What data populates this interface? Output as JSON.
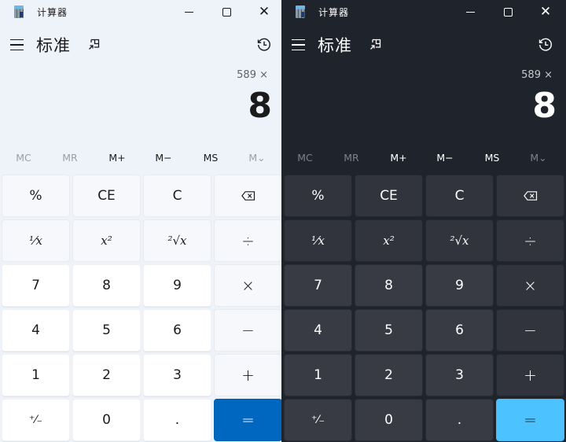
{
  "panels": [
    {
      "theme": "light",
      "app_title": "计算器",
      "mode_title": "标准",
      "expression": "589 ×",
      "result": "8",
      "memory": [
        "MC",
        "MR",
        "M+",
        "M−",
        "MS",
        "M⌄"
      ],
      "memory_disabled": [
        true,
        true,
        false,
        false,
        false,
        true
      ],
      "keys": [
        {
          "label": "%",
          "name": "percent",
          "kind": "fn"
        },
        {
          "label": "CE",
          "name": "clear-entry",
          "kind": "fn"
        },
        {
          "label": "C",
          "name": "clear",
          "kind": "fn"
        },
        {
          "label": "",
          "name": "backspace",
          "kind": "fn",
          "icon": "backspace-icon"
        },
        {
          "label": "¹⁄x",
          "name": "reciprocal",
          "kind": "fn",
          "style": "serif"
        },
        {
          "label": "x²",
          "name": "square",
          "kind": "fn",
          "style": "serif"
        },
        {
          "label": "²√x",
          "name": "square-root",
          "kind": "fn",
          "style": "serif"
        },
        {
          "label": "÷",
          "name": "divide",
          "kind": "fn",
          "style": "op"
        },
        {
          "label": "7",
          "name": "digit-7",
          "kind": "num"
        },
        {
          "label": "8",
          "name": "digit-8",
          "kind": "num"
        },
        {
          "label": "9",
          "name": "digit-9",
          "kind": "num"
        },
        {
          "label": "×",
          "name": "multiply",
          "kind": "fn",
          "style": "op"
        },
        {
          "label": "4",
          "name": "digit-4",
          "kind": "num"
        },
        {
          "label": "5",
          "name": "digit-5",
          "kind": "num"
        },
        {
          "label": "6",
          "name": "digit-6",
          "kind": "num"
        },
        {
          "label": "−",
          "name": "subtract",
          "kind": "fn",
          "style": "op"
        },
        {
          "label": "1",
          "name": "digit-1",
          "kind": "num"
        },
        {
          "label": "2",
          "name": "digit-2",
          "kind": "num"
        },
        {
          "label": "3",
          "name": "digit-3",
          "kind": "num"
        },
        {
          "label": "+",
          "name": "add",
          "kind": "fn",
          "style": "op"
        },
        {
          "label": "⁺⁄₋",
          "name": "negate",
          "kind": "num",
          "style": "small"
        },
        {
          "label": "0",
          "name": "digit-0",
          "kind": "num"
        },
        {
          "label": ".",
          "name": "decimal",
          "kind": "num"
        },
        {
          "label": "=",
          "name": "equals",
          "kind": "eq",
          "style": "op"
        }
      ],
      "accent_color": "#0067c0"
    },
    {
      "theme": "dark",
      "app_title": "计算器",
      "mode_title": "标准",
      "expression": "589 ×",
      "result": "8",
      "memory": [
        "MC",
        "MR",
        "M+",
        "M−",
        "MS",
        "M⌄"
      ],
      "memory_disabled": [
        true,
        true,
        false,
        false,
        false,
        true
      ],
      "keys": [
        {
          "label": "%",
          "name": "percent",
          "kind": "fn"
        },
        {
          "label": "CE",
          "name": "clear-entry",
          "kind": "fn"
        },
        {
          "label": "C",
          "name": "clear",
          "kind": "fn"
        },
        {
          "label": "",
          "name": "backspace",
          "kind": "fn",
          "icon": "backspace-icon"
        },
        {
          "label": "¹⁄x",
          "name": "reciprocal",
          "kind": "fn",
          "style": "serif"
        },
        {
          "label": "x²",
          "name": "square",
          "kind": "fn",
          "style": "serif"
        },
        {
          "label": "²√x",
          "name": "square-root",
          "kind": "fn",
          "style": "serif"
        },
        {
          "label": "÷",
          "name": "divide",
          "kind": "fn",
          "style": "op"
        },
        {
          "label": "7",
          "name": "digit-7",
          "kind": "num"
        },
        {
          "label": "8",
          "name": "digit-8",
          "kind": "num"
        },
        {
          "label": "9",
          "name": "digit-9",
          "kind": "num"
        },
        {
          "label": "×",
          "name": "multiply",
          "kind": "fn",
          "style": "op"
        },
        {
          "label": "4",
          "name": "digit-4",
          "kind": "num"
        },
        {
          "label": "5",
          "name": "digit-5",
          "kind": "num"
        },
        {
          "label": "6",
          "name": "digit-6",
          "kind": "num"
        },
        {
          "label": "−",
          "name": "subtract",
          "kind": "fn",
          "style": "op"
        },
        {
          "label": "1",
          "name": "digit-1",
          "kind": "num"
        },
        {
          "label": "2",
          "name": "digit-2",
          "kind": "num"
        },
        {
          "label": "3",
          "name": "digit-3",
          "kind": "num"
        },
        {
          "label": "+",
          "name": "add",
          "kind": "fn",
          "style": "op"
        },
        {
          "label": "⁺⁄₋",
          "name": "negate",
          "kind": "num",
          "style": "small"
        },
        {
          "label": "0",
          "name": "digit-0",
          "kind": "num"
        },
        {
          "label": ".",
          "name": "decimal",
          "kind": "num"
        },
        {
          "label": "=",
          "name": "equals",
          "kind": "eq",
          "style": "op"
        }
      ],
      "accent_color": "#4cc2ff"
    }
  ],
  "icons": {
    "app": "calculator-icon",
    "minimize": "minimize-icon",
    "maximize": "maximize-icon",
    "close": "close-icon",
    "menu": "hamburger-menu-icon",
    "keep_on_top": "keep-on-top-icon",
    "history": "history-icon"
  }
}
